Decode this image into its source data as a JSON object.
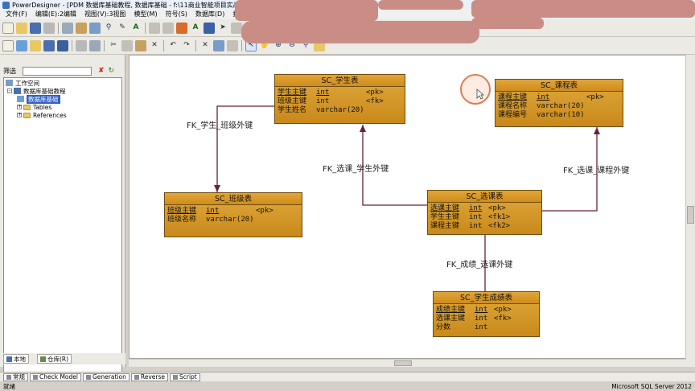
{
  "window": {
    "title": "PowerDesigner - [PDM 数据库基础教程, 数据库基础 - f:\\11商业智能项目实战\\"
  },
  "menu": [
    "文件(F)",
    "编辑(E):2编辑",
    "视图(V):3视图",
    "模型(M)",
    "符号(S)",
    "数据库(D)",
    "报"
  ],
  "toolbar1_icons": [
    "new-icon",
    "open-icon",
    "save-icon",
    "print-icon",
    "copy-icon",
    "paste-icon",
    "properties-icon",
    "zoom-icon",
    "find-icon",
    "text-icon",
    "bold-icon",
    "align-icon",
    "color-icon",
    "fill-icon",
    "line-icon",
    "arrow-icon",
    "shape-icon",
    "font-icon"
  ],
  "toolbar2_icons": [
    "new-model-icon",
    "open-model-icon",
    "folder-icon",
    "save-model-icon",
    "save-all-icon",
    "print-model-icon",
    "preview-icon",
    "cut-icon",
    "copy-model-icon",
    "paste-model-icon",
    "delete-icon",
    "undo-icon",
    "redo-icon",
    "delete-model-icon",
    "properties-model-icon",
    "check-icon",
    "pointer-icon",
    "grabber-icon",
    "zoom-in-icon",
    "zoom-out-icon",
    "zoom-fit-icon",
    "open-package-icon"
  ],
  "browser": {
    "filter_label": "筛选",
    "filter_value": "",
    "tree": [
      {
        "label": "工作空间",
        "level": 0,
        "icon": "workspace-icon"
      },
      {
        "label": "数据库基础教程",
        "level": 1,
        "icon": "pdm-icon",
        "expander": "-"
      },
      {
        "label": "数据库基础",
        "level": 2,
        "icon": "diagram-icon",
        "selected": true
      },
      {
        "label": "Tables",
        "level": 2,
        "icon": "folder-icon",
        "expander": "+"
      },
      {
        "label": "References",
        "level": 2,
        "icon": "folder-icon",
        "expander": "+"
      }
    ],
    "tabs": [
      "本地",
      "仓库(R)"
    ]
  },
  "entities": {
    "student": {
      "name": "SC_学生表",
      "rows": [
        {
          "name": "学生主键",
          "type": "int",
          "key": "<pk>"
        },
        {
          "name": "班级主键",
          "type": "int",
          "key": "<fk>"
        },
        {
          "name": "学生姓名",
          "type": "varchar(20)",
          "key": ""
        }
      ]
    },
    "course": {
      "name": "SC_课程表",
      "rows": [
        {
          "name": "课程主键",
          "type": "int",
          "key": "<pk>"
        },
        {
          "name": "课程名称",
          "type": "varchar(20)",
          "key": ""
        },
        {
          "name": "课程编号",
          "type": "varchar(10)",
          "key": ""
        }
      ]
    },
    "class": {
      "name": "SC_班级表",
      "rows": [
        {
          "name": "班级主键",
          "type": "int",
          "key": "<pk>"
        },
        {
          "name": "班级名称",
          "type": "varchar(20)",
          "key": ""
        }
      ]
    },
    "selection": {
      "name": "SC_选课表",
      "rows": [
        {
          "name": "选课主键",
          "type": "int",
          "key": "<pk>"
        },
        {
          "name": "学生主键",
          "type": "int",
          "key": "<fk1>"
        },
        {
          "name": "课程主键",
          "type": "int",
          "key": "<fk2>"
        }
      ]
    },
    "grade": {
      "name": "SC_学生成绩表",
      "rows": [
        {
          "name": "成绩主键",
          "type": "int",
          "key": "<pk>"
        },
        {
          "name": "选课主键",
          "type": "int",
          "key": "<fk>"
        },
        {
          "name": "分数",
          "type": "int",
          "key": ""
        }
      ]
    }
  },
  "references": {
    "student_class": "FK_学生_班级外键",
    "selection_student": "FK_选课_学生外键",
    "selection_course": "FK_选课_课程外键",
    "grade_selection": "FK_成绩_选课外键"
  },
  "bottom_tabs": [
    "常规",
    "Check Model",
    "Generation",
    "Reverse",
    "Script"
  ],
  "status": {
    "left": "就绪",
    "right": "Microsoft SQL Server 2012"
  },
  "colors": {
    "entity_fill": "#d6951e",
    "entity_border": "#6e4c0c",
    "reference_line": "#6b1f3e",
    "accent": "#3160c4"
  }
}
